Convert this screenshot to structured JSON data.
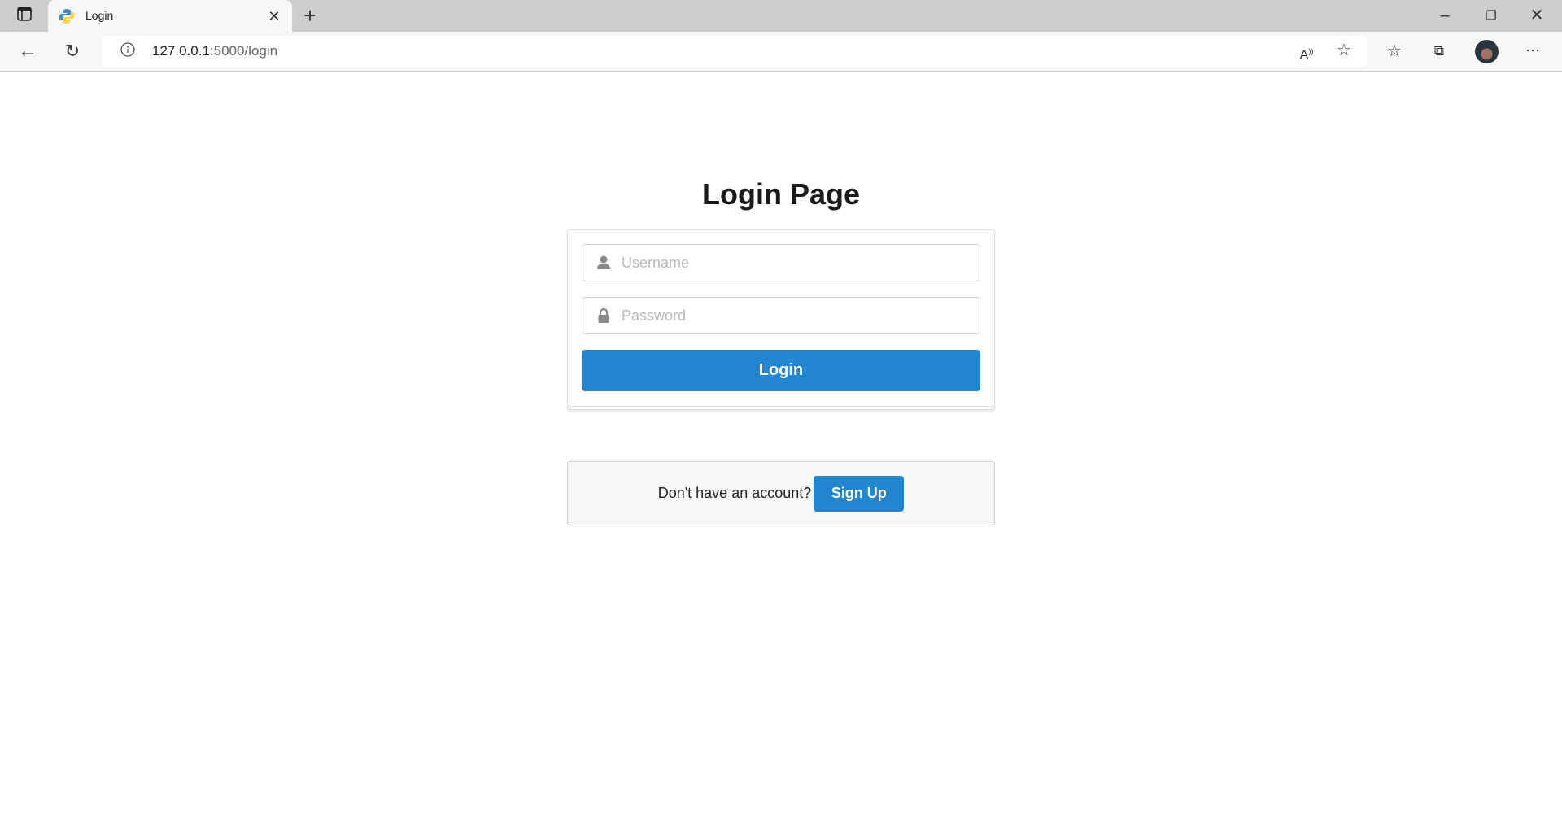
{
  "browser": {
    "tab_title": "Login",
    "url_host": "127.0.0.1",
    "url_rest": ":5000/login",
    "icons": [
      "sidebar-toggle-icon",
      "python-icon",
      "close-icon",
      "new-tab-icon",
      "back-icon",
      "refresh-icon",
      "info-icon",
      "read-aloud-icon",
      "add-favorite-icon",
      "favorites-icon",
      "collections-icon",
      "profile-avatar",
      "more-icon",
      "minimize-icon",
      "restore-icon",
      "window-close-icon"
    ]
  },
  "page": {
    "title": "Login Page",
    "username_placeholder": "Username",
    "password_placeholder": "Password",
    "login_label": "Login",
    "signup_prompt": "Don't have an account?",
    "signup_label": "Sign Up"
  },
  "colors": {
    "primary": "#2185d0"
  }
}
